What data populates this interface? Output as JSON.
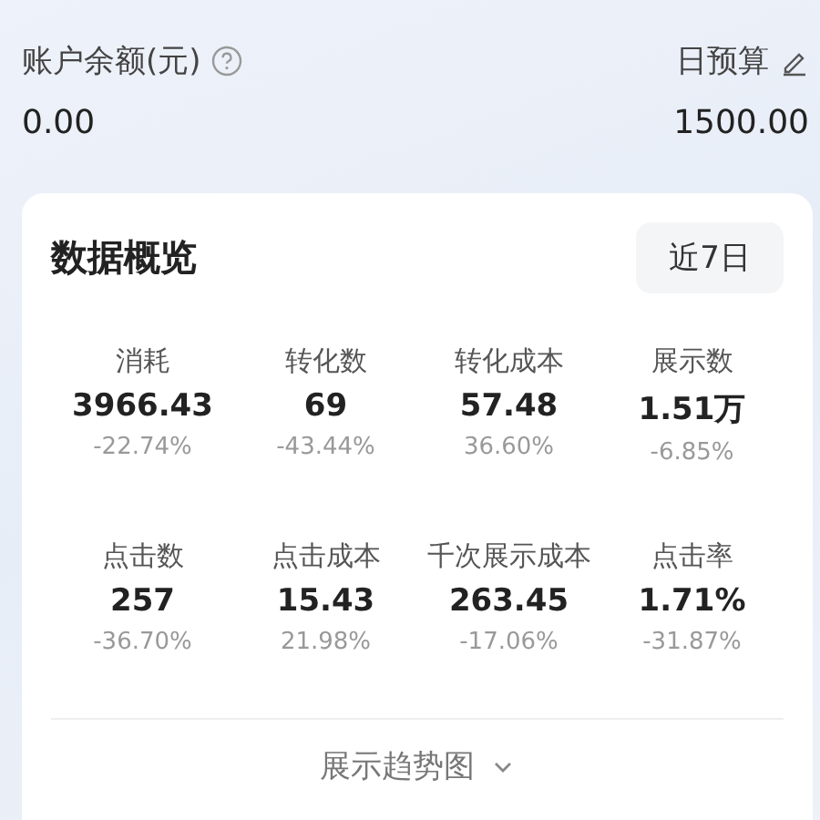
{
  "balance": {
    "label": "账户余额(元)",
    "value": "0.00"
  },
  "budget": {
    "label": "日预算",
    "value": "1500.00"
  },
  "overview": {
    "title": "数据概览",
    "range": "近7日",
    "metrics": [
      {
        "label": "消耗",
        "value": "3966.43",
        "change": "-22.74%"
      },
      {
        "label": "转化数",
        "value": "69",
        "change": "-43.44%"
      },
      {
        "label": "转化成本",
        "value": "57.48",
        "change": "36.60%"
      },
      {
        "label": "展示数",
        "value": "1.51万",
        "change": "-6.85%"
      },
      {
        "label": "点击数",
        "value": "257",
        "change": "-36.70%"
      },
      {
        "label": "点击成本",
        "value": "15.43",
        "change": "21.98%"
      },
      {
        "label": "千次展示成本",
        "value": "263.45",
        "change": "-17.06%"
      },
      {
        "label": "点击率",
        "value": "1.71%",
        "change": "-31.87%"
      }
    ],
    "trend_toggle": {
      "label": "展示趋势图",
      "expanded": false
    }
  }
}
